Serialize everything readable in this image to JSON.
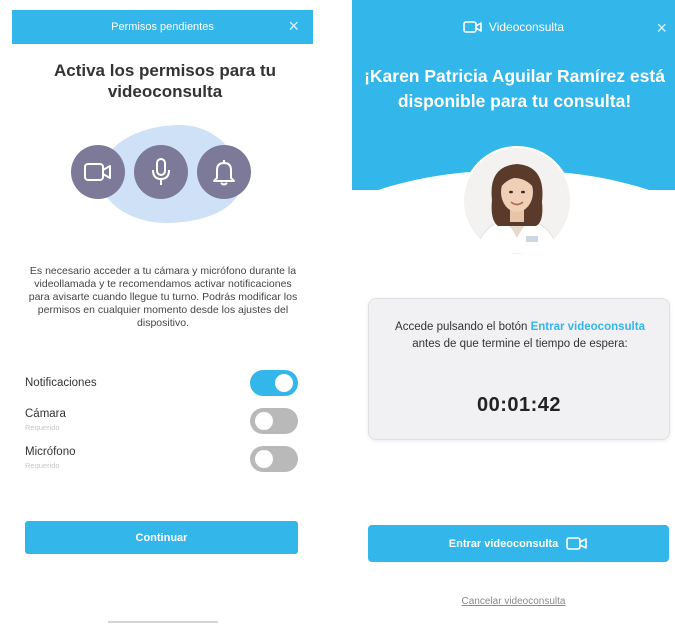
{
  "left_screen": {
    "header_title": "Permisos pendientes",
    "close_symbol": "×",
    "title": "Activa los permisos para tu videoconsulta",
    "description": "Es necesario acceder a tu cámara y micrófono durante la videollamada y te recomendamos activar notificaciones para avisarte cuando llegue tu turno. Podrás modificar los permisos en cualquier momento desde los ajustes del dispositivo.",
    "icons": [
      "camera-icon",
      "microphone-icon",
      "bell-icon"
    ],
    "permissions": [
      {
        "label": "Notificaciones",
        "sublabel": "",
        "enabled": true
      },
      {
        "label": "Cámara",
        "sublabel": "Requerido",
        "enabled": false
      },
      {
        "label": "Micrófono",
        "sublabel": "Requerido",
        "enabled": false
      }
    ],
    "continue_label": "Continuar"
  },
  "right_screen": {
    "header_title": "Videoconsulta",
    "close_symbol": "×",
    "title": "¡Karen Patricia Aguilar Ramírez está disponible para tu consulta!",
    "card": {
      "text_before": "Accede pulsando el botón ",
      "link_text": "Entrar videoconsulta",
      "text_after": " antes de que termine el tiempo de espera:",
      "timer": "00:01:42"
    },
    "enter_label": "Entrar videoconsulta",
    "cancel_label": "Cancelar videoconsulta"
  },
  "colors": {
    "accent": "#33b6ea",
    "icon_circle": "#7c7a98",
    "blob": "#cfe1f7",
    "toggle_off": "#b9b9b9"
  }
}
